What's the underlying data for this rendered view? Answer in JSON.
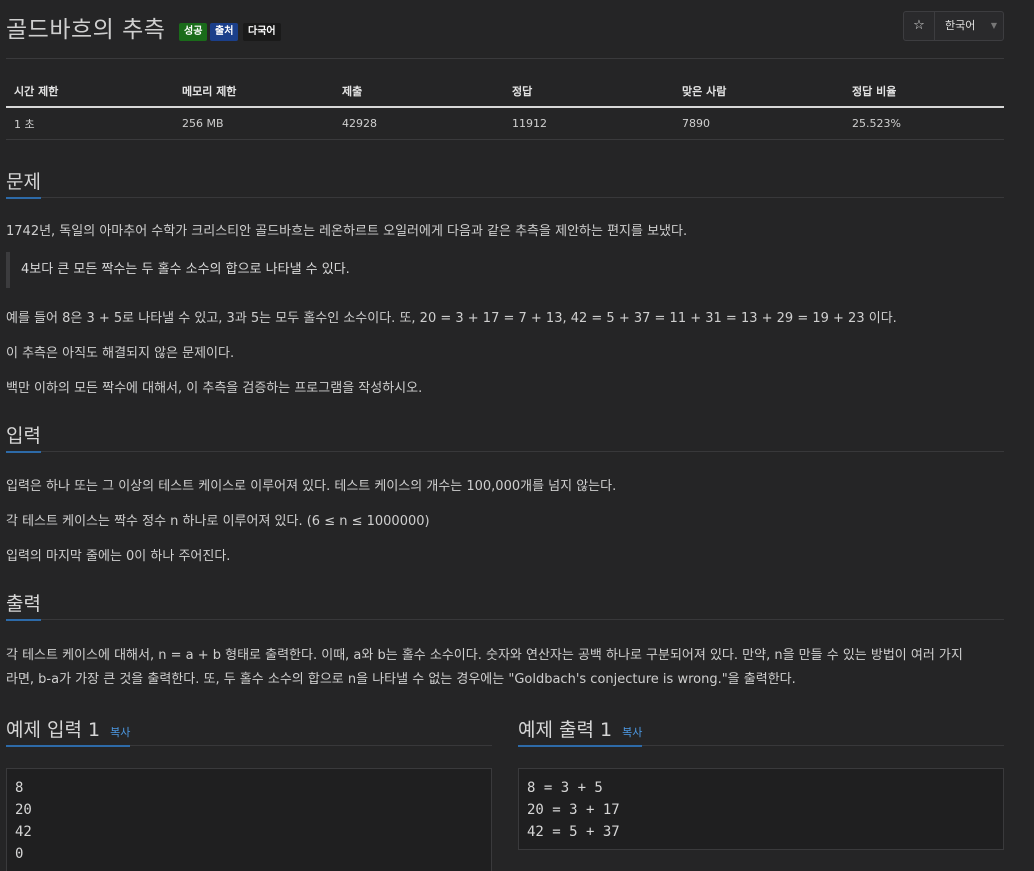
{
  "header": {
    "title": "골드바흐의 추측",
    "badges": {
      "success": "성공",
      "source": "출처",
      "multilang": "다국어"
    },
    "star_icon": "☆",
    "language": "한국어"
  },
  "info_table": {
    "headers": [
      "시간 제한",
      "메모리 제한",
      "제출",
      "정답",
      "맞은 사람",
      "정답 비율"
    ],
    "values": [
      "1 초",
      "256 MB",
      "42928",
      "11912",
      "7890",
      "25.523%"
    ]
  },
  "problem": {
    "heading": "문제",
    "p1": "1742년, 독일의 아마추어 수학가 크리스티안 골드바흐는 레온하르트 오일러에게 다음과 같은 추측을 제안하는 편지를 보냈다.",
    "quote": "4보다 큰 모든 짝수는 두 홀수 소수의 합으로 나타낼 수 있다.",
    "p2": "예를 들어 8은 3 + 5로 나타낼 수 있고, 3과 5는 모두 홀수인 소수이다. 또, 20 = 3 + 17 = 7 + 13, 42 = 5 + 37 = 11 + 31 = 13 + 29 = 19 + 23 이다.",
    "p3": "이 추측은 아직도 해결되지 않은 문제이다.",
    "p4": "백만 이하의 모든 짝수에 대해서, 이 추측을 검증하는 프로그램을 작성하시오."
  },
  "input": {
    "heading": "입력",
    "p1": "입력은 하나 또는 그 이상의 테스트 케이스로 이루어져 있다. 테스트 케이스의 개수는 100,000개를 넘지 않는다.",
    "p2": "각 테스트 케이스는 짝수 정수 n 하나로 이루어져 있다. (6 ≤ n ≤ 1000000)",
    "p3": "입력의 마지막 줄에는 0이 하나 주어진다."
  },
  "output": {
    "heading": "출력",
    "p1_line1": "각 테스트 케이스에 대해서, n = a + b 형태로 출력한다. 이때, a와 b는 홀수 소수이다. 숫자와 연산자는 공백 하나로 구분되어져 있다. 만약, n을 만들 수 있는 방법이 여러 가지",
    "p1_line2": "라면, b-a가 가장 큰 것을 출력한다. 또, 두 홀수 소수의 합으로 n을 나타낼 수 없는 경우에는 \"Goldbach's conjecture is wrong.\"을 출력한다."
  },
  "samples": {
    "input_heading": "예제 입력 1",
    "output_heading": "예제 출력 1",
    "copy_label": "복사",
    "input_text": "8\n20\n42\n0",
    "output_text": "8 = 3 + 5\n20 = 3 + 17\n42 = 5 + 37"
  }
}
